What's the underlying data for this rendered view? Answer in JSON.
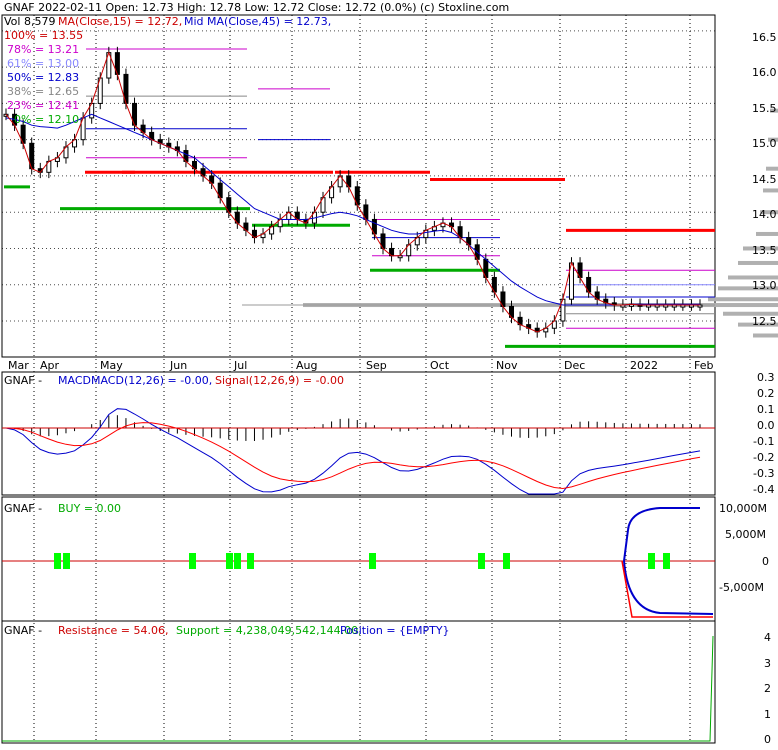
{
  "header": {
    "line1": "GNAF  2022-02-11 Open: 12.73  High: 12.78  Low: 12.72  Close: 12.72 (0.0%)  (c) Stoxline.com",
    "vol_label": "Vol 8,579",
    "ma15_label": "MA(Close,15) = 12.72,",
    "ma45_label": "Mid MA(Close,45) = 12.73,"
  },
  "colors": {
    "candle": "#000000",
    "ma15": "#cc0000",
    "ma45": "#0000cc",
    "resistance": "#ff0000",
    "support": "#00aa00",
    "volume_profile": "#b0b0b0",
    "fib_100": "#cc0000",
    "fib_78": "#cc00cc",
    "fib_61": "#8888ff",
    "fib_50": "#0000cc",
    "fib_38": "#888888",
    "fib_23": "#cc00cc",
    "fib_0": "#00aa00",
    "buy": "#00ff00"
  },
  "chart_data": [
    {
      "type": "candlestick",
      "panel": "price",
      "x_ticks": [
        "Mar",
        "Apr",
        "May",
        "Jun",
        "Jul",
        "Aug",
        "Sep",
        "Oct",
        "Nov",
        "Dec",
        "2022",
        "Feb"
      ],
      "y_ticks": [
        "16.5",
        "16.0",
        "15.5",
        "15.0",
        "14.5",
        "14.0",
        "13.5",
        "13.0",
        "12.5"
      ],
      "ylim": [
        12.1,
        16.65
      ],
      "close": [
        15.35,
        15.2,
        14.95,
        14.6,
        14.55,
        14.7,
        14.75,
        14.9,
        15.0,
        15.3,
        15.5,
        15.85,
        16.2,
        15.9,
        15.5,
        15.2,
        15.1,
        15.0,
        14.95,
        14.9,
        14.85,
        14.7,
        14.6,
        14.5,
        14.4,
        14.2,
        14.0,
        13.85,
        13.75,
        13.65,
        13.7,
        13.8,
        13.9,
        14.0,
        13.9,
        13.85,
        14.0,
        14.2,
        14.35,
        14.5,
        14.35,
        14.1,
        13.9,
        13.7,
        13.5,
        13.4,
        13.4,
        13.55,
        13.65,
        13.75,
        13.8,
        13.85,
        13.8,
        13.65,
        13.55,
        13.35,
        13.1,
        12.9,
        12.7,
        12.55,
        12.45,
        12.4,
        12.35,
        12.4,
        12.5,
        12.8,
        13.3,
        13.1,
        12.9,
        12.8,
        12.75,
        12.72,
        12.72,
        12.73,
        12.72,
        12.72,
        12.72,
        12.72,
        12.72,
        12.72,
        12.72,
        12.72
      ],
      "ma15": [
        15.35,
        15.2,
        14.95,
        14.6,
        14.55,
        14.7,
        14.75,
        14.9,
        15.0,
        15.3,
        15.5,
        15.85,
        16.2,
        15.9,
        15.5,
        15.2,
        15.1,
        15.0,
        14.95,
        14.9,
        14.85,
        14.7,
        14.6,
        14.5,
        14.4,
        14.2,
        14.0,
        13.85,
        13.75,
        13.65,
        13.7,
        13.8,
        13.9,
        14.0,
        13.9,
        13.85,
        14.0,
        14.2,
        14.35,
        14.5,
        14.35,
        14.1,
        13.9,
        13.7,
        13.5,
        13.4,
        13.4,
        13.55,
        13.65,
        13.75,
        13.8,
        13.85,
        13.8,
        13.65,
        13.55,
        13.35,
        13.1,
        12.9,
        12.7,
        12.55,
        12.45,
        12.4,
        12.35,
        12.4,
        12.5,
        12.8,
        13.3,
        13.1,
        12.9,
        12.8,
        12.75,
        12.72,
        12.72,
        12.73,
        12.72,
        12.72,
        12.72,
        12.72,
        12.72,
        12.72,
        12.72,
        12.72
      ],
      "ma45": [
        15.3,
        15.28,
        15.25,
        15.2,
        15.18,
        15.17,
        15.16,
        15.2,
        15.25,
        15.3,
        15.35,
        15.3,
        15.25,
        15.2,
        15.15,
        15.1,
        15.05,
        15.0,
        14.95,
        14.9,
        14.85,
        14.8,
        14.75,
        14.65,
        14.55,
        14.45,
        14.35,
        14.25,
        14.15,
        14.05,
        14.0,
        13.95,
        13.9,
        13.9,
        13.9,
        13.9,
        13.92,
        13.95,
        13.98,
        14.0,
        13.98,
        13.95,
        13.9,
        13.85,
        13.8,
        13.75,
        13.72,
        13.7,
        13.7,
        13.72,
        13.74,
        13.75,
        13.72,
        13.65,
        13.55,
        13.45,
        13.35,
        13.25,
        13.15,
        13.05,
        12.97,
        12.9,
        12.83,
        12.78,
        12.75,
        12.72,
        12.72,
        12.72,
        12.72,
        12.72,
        12.72,
        12.72,
        12.72,
        12.73,
        12.73,
        12.73,
        12.73,
        12.73,
        12.73,
        12.73,
        12.73,
        12.73
      ],
      "fib_levels": [
        {
          "label": "100% = 13.55",
          "key": "fib_100"
        },
        {
          "label": "78% = 13.21",
          "key": "fib_78"
        },
        {
          "label": "61% = 13.00",
          "key": "fib_61"
        },
        {
          "label": "50% = 12.83",
          "key": "fib_50"
        },
        {
          "label": "38% = 12.65",
          "key": "fib_38"
        },
        {
          "label": "23% = 12.41",
          "key": "fib_23"
        },
        {
          "label": "0% = 12.10",
          "key": "fib_0"
        }
      ]
    },
    {
      "type": "line",
      "panel": "macd",
      "label_prefix": "GNAF - ",
      "macd_label": "MACDMACD(12,26) = -0.00,",
      "signal_label": "Signal(12,26,9) = -0.00",
      "y_ticks": [
        "0.3",
        "0.2",
        "0.1",
        "0.0",
        "-0.1",
        "-0.2",
        "-0.3",
        "-0.4"
      ],
      "ylim": [
        -0.4,
        0.3
      ]
    },
    {
      "type": "line",
      "panel": "buy",
      "label_prefix": "GNAF - ",
      "buy_label": "BUY = 0.00",
      "y_ticks": [
        "10,000M",
        "5,000M",
        "0",
        "-5,000M"
      ]
    },
    {
      "type": "line",
      "panel": "resistance",
      "label_prefix": "GNAF - ",
      "resistance_label": "Resistance = 54.06,",
      "support_label": "Support = 4,238,049,542,144.00,",
      "position_label": "Position = {EMPTY}",
      "y_ticks": [
        "4",
        "3",
        "2",
        "1",
        "0"
      ],
      "ylim": [
        0,
        4.2
      ]
    }
  ]
}
